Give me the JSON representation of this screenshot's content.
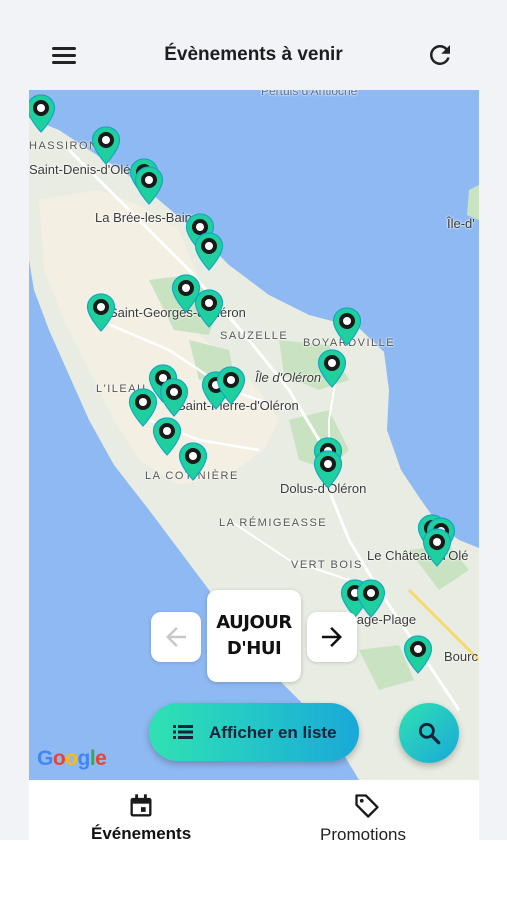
{
  "header": {
    "title": "Évènements à venir",
    "menu_icon": "hamburger-menu-icon",
    "refresh_icon": "refresh-icon"
  },
  "map": {
    "places": {
      "pertuis": "Pertuis d'Antioche",
      "chassiron": "HASSIRON",
      "saint_denis": "Saint-Denis-d'Oléron",
      "la_bree": "La Brée-les-Bains",
      "ile_daix": "Île-d'",
      "saint_georges": "Saint-Georges-d'Oléron",
      "sauzelle": "SAUZELLE",
      "boyardville": "BOYARDVILLE",
      "ile_oleron": "Île d'Oléron",
      "lilea": "L'ILEAU",
      "saint_pierre": "Saint-Pierre-d'Oléron",
      "cotiniere": "LA COTINIÈRE",
      "dolus": "Dolus-d'Oléron",
      "remigeasse": "LA RÉMIGEASSE",
      "vert_bois": "VERT BOIS",
      "chateau": "Le Château-d'Olé",
      "plage": "llage-Plage",
      "bourc": "Bourc"
    },
    "attribution": "Google",
    "pin_count": 31,
    "colors": {
      "water": "#8fb9f2",
      "land": "#e8ece2",
      "pin": "#1fcf9e",
      "pin_dot": "#1a1a1a"
    }
  },
  "date_nav": {
    "prev_icon": "arrow-left-icon",
    "next_icon": "arrow-right-icon",
    "today_line1": "AUJOUR",
    "today_line2": "D'HUI"
  },
  "actions": {
    "list_label": "Afficher en liste",
    "list_icon": "list-icon",
    "search_icon": "search-icon"
  },
  "bottom_nav": {
    "tabs": [
      {
        "label": "Événements",
        "icon": "calendar-icon",
        "active": true
      },
      {
        "label": "Promotions",
        "icon": "tag-icon",
        "active": false
      }
    ],
    "accent": "#2fd69a"
  }
}
